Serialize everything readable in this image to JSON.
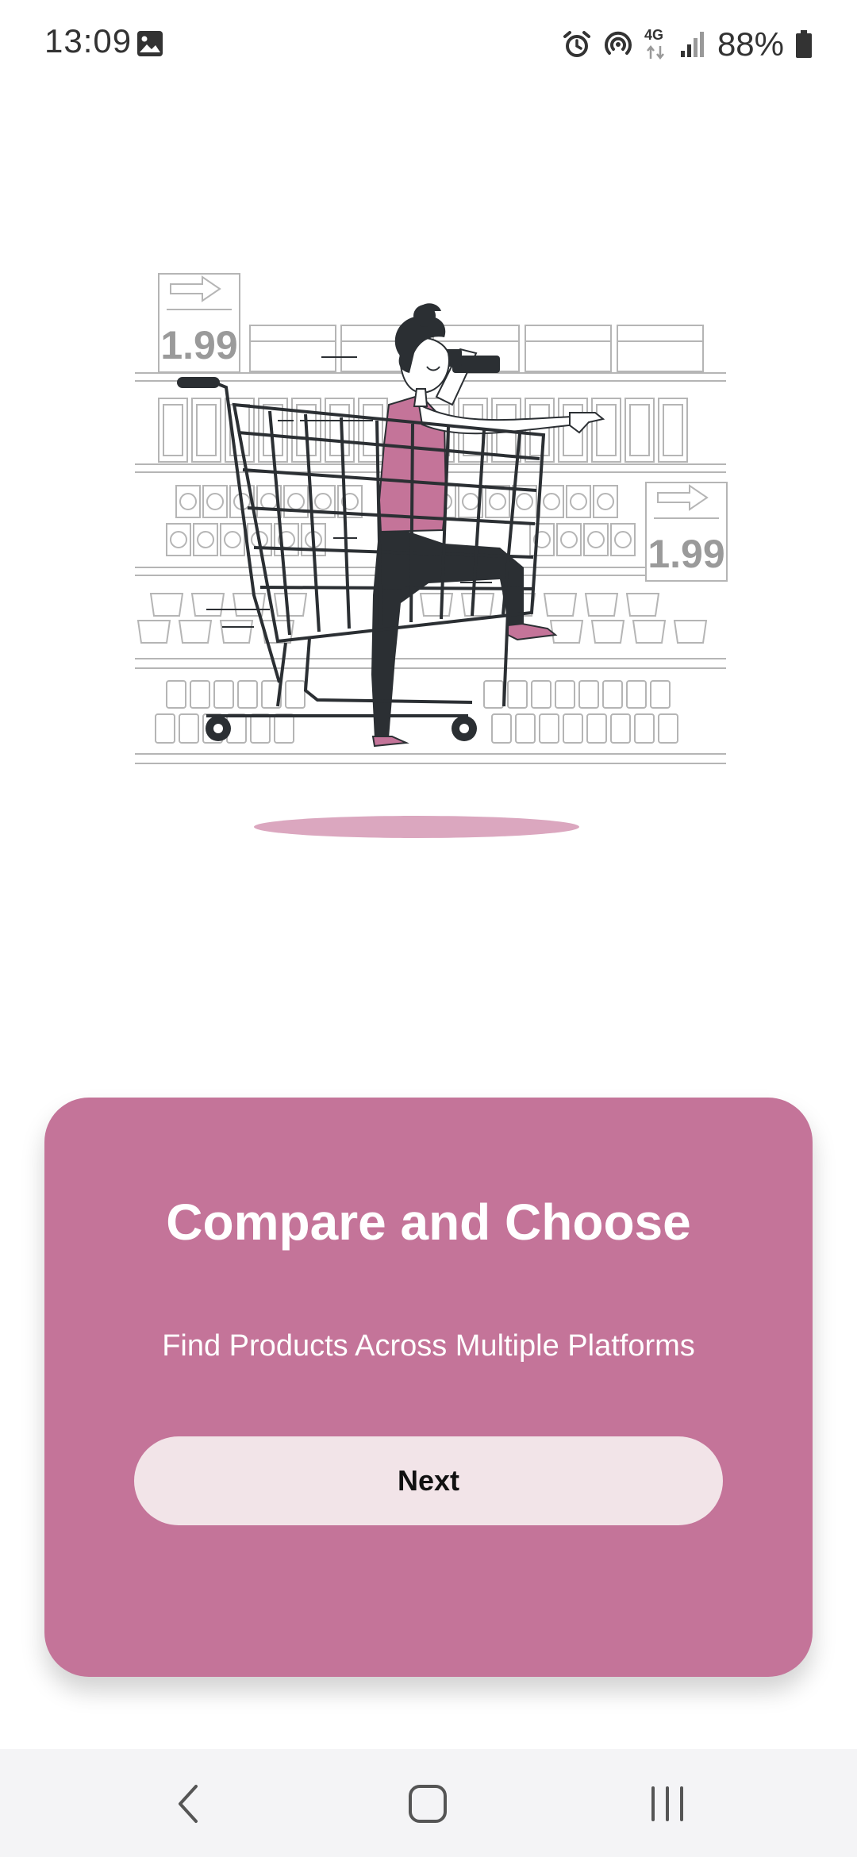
{
  "status_bar": {
    "time": "13:09",
    "network": "4G",
    "battery": "88%",
    "icons": [
      "gallery-icon",
      "alarm-icon",
      "hotspot-icon",
      "network-4g-icon",
      "signal-icon",
      "battery-icon"
    ]
  },
  "illustration": {
    "price_tags": [
      "1.99",
      "1.99"
    ],
    "accent_color": "#c47499",
    "dark_color": "#2b2f33"
  },
  "onboarding_card": {
    "title": "Compare and Choose",
    "subtitle": "Find Products Across Multiple Platforms",
    "next_label": "Next",
    "background_color": "#c47499",
    "button_color": "#f2e4e8"
  },
  "nav_bar": {
    "buttons": [
      "back-icon",
      "home-icon",
      "recents-icon"
    ]
  }
}
